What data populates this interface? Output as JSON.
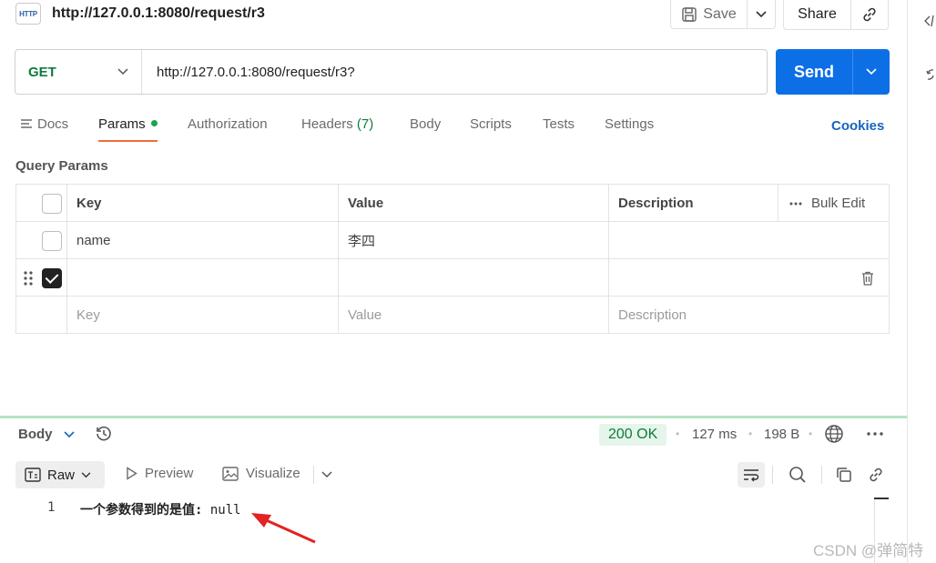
{
  "request": {
    "icon_label": "HTTP",
    "title": "http://127.0.0.1:8080/request/r3",
    "save_label": "Save",
    "share_label": "Share",
    "method": "GET",
    "url": "http://127.0.0.1:8080/request/r3?",
    "send_label": "Send"
  },
  "tabs": {
    "docs": "Docs",
    "params": "Params",
    "authorization": "Authorization",
    "headers": "Headers",
    "headers_count": "(7)",
    "body": "Body",
    "scripts": "Scripts",
    "tests": "Tests",
    "settings": "Settings",
    "cookies": "Cookies"
  },
  "params": {
    "section_title": "Query Params",
    "headers": {
      "key": "Key",
      "value": "Value",
      "description": "Description",
      "bulk_edit": "Bulk Edit"
    },
    "rows": [
      {
        "key": "name",
        "value": "李四",
        "description": "",
        "checked": false
      },
      {
        "key": "",
        "value": "",
        "description": "",
        "checked": true
      }
    ],
    "placeholders": {
      "key": "Key",
      "value": "Value",
      "description": "Description"
    }
  },
  "response": {
    "body_label": "Body",
    "status": "200 OK",
    "time": "127 ms",
    "size": "198 B",
    "view_raw": "Raw",
    "view_preview": "Preview",
    "view_visualize": "Visualize",
    "line_number": "1",
    "line_text": "一个参数得到的是值: ",
    "line_value": "null"
  },
  "watermark": "CSDN @弹简特",
  "colors": {
    "send": "#0d6fe6",
    "method": "#0f7b3c",
    "active_tab_underline": "#f26b3a",
    "status_ok": "#0f7b3c",
    "annotation_arrow": "#e32222"
  }
}
